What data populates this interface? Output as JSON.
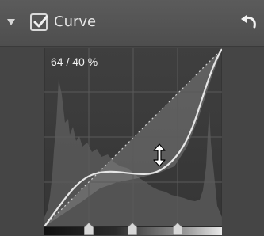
{
  "panel": {
    "title": "Curve",
    "enabled": true
  },
  "curve": {
    "readout": "64 / 40 %"
  },
  "icons": {
    "collapse": "triangle-down-icon",
    "checkbox": "check-icon",
    "reset": "undo-arrow-icon",
    "cursor": "vertical-resize-cursor-icon"
  },
  "colors": {
    "panel_bg": "#454545",
    "curve_area_bg": "#3d3d3d",
    "curve_line": "#e6e6e6",
    "text": "#e8e8e8"
  }
}
